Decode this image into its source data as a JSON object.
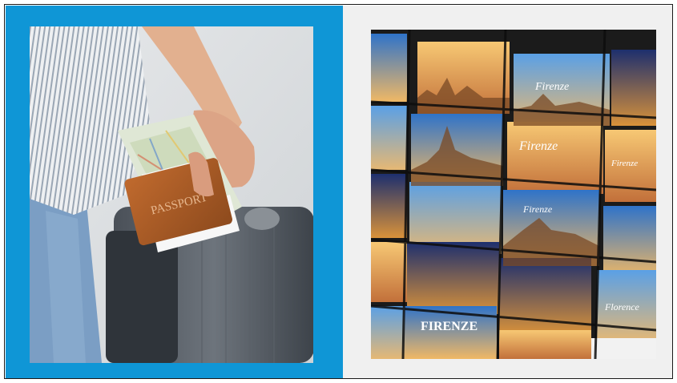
{
  "slide": {
    "left_panel": {
      "background_color": "#0f96d6",
      "image": {
        "subject": "traveler-with-passport-map-and-suitcase",
        "passport_text": "PASSPORT"
      }
    },
    "right_panel": {
      "background_color": "#f0f0f0",
      "image": {
        "subject": "florence-postcard-rack",
        "postcard_texts": [
          "Firenze",
          "Firenze",
          "Firenze",
          "Florence",
          "FIRENZE",
          "Firenze"
        ]
      }
    }
  }
}
